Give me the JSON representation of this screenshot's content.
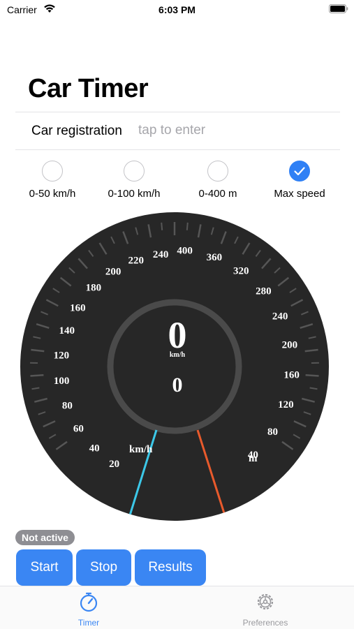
{
  "status_bar": {
    "carrier": "Carrier",
    "time": "6:03 PM"
  },
  "title": "Car Timer",
  "registration": {
    "label": "Car registration",
    "placeholder": "tap to enter",
    "value": ""
  },
  "modes": [
    {
      "label": "0-50 km/h",
      "selected": false
    },
    {
      "label": "0-100 km/h",
      "selected": false
    },
    {
      "label": "0-400 m",
      "selected": false
    },
    {
      "label": "Max speed",
      "selected": true
    }
  ],
  "gauge": {
    "speed_scale": [
      "20",
      "40",
      "60",
      "80",
      "100",
      "120",
      "140",
      "160",
      "180",
      "200",
      "220",
      "240"
    ],
    "speed_unit": "km/h",
    "distance_scale": [
      "400",
      "360",
      "320",
      "280",
      "240",
      "200",
      "160",
      "120",
      "80",
      "40"
    ],
    "distance_unit": "m",
    "current_speed": "0",
    "current_speed_unit": "km/h",
    "secondary_value": "0",
    "speed_needle_color": "#3cc8e8",
    "distance_needle_color": "#e85a2c",
    "dial_color": "#272727"
  },
  "status_badge": "Not active",
  "buttons": {
    "start": "Start",
    "stop": "Stop",
    "results": "Results"
  },
  "tabs": [
    {
      "label": "Timer",
      "icon": "stopwatch-icon",
      "active": true
    },
    {
      "label": "Preferences",
      "icon": "gear-icon",
      "active": false
    }
  ],
  "colors": {
    "accent": "#3a86f3",
    "badge": "#8e8e93",
    "inactive_tab": "#9a9a9e"
  }
}
